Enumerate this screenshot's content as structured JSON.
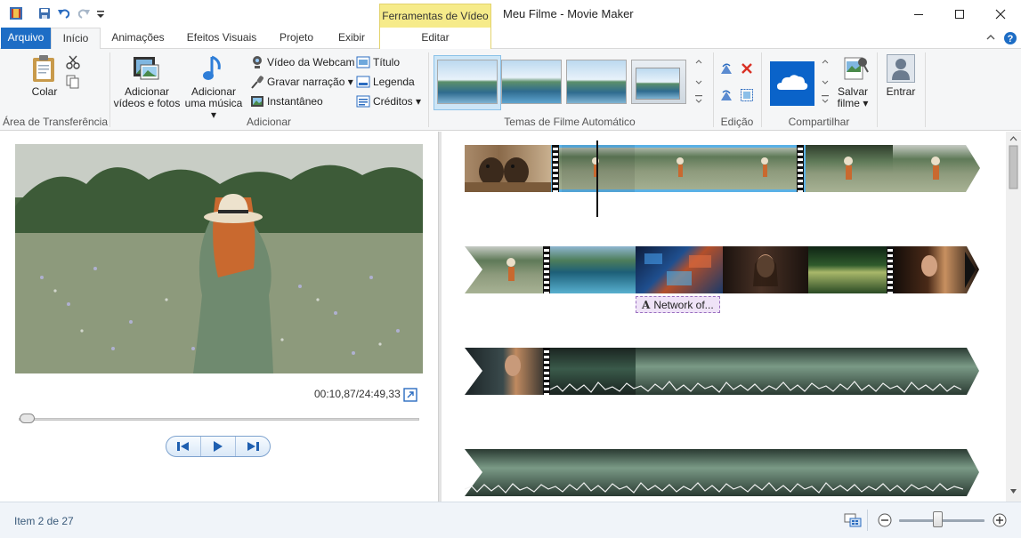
{
  "window": {
    "title": "Meu Filme - Movie Maker",
    "context_tab_header": "Ferramentas de Vídeo"
  },
  "tabs": {
    "file": "Arquivo",
    "home": "Início",
    "animations": "Animações",
    "visual_effects": "Efeitos Visuais",
    "project": "Projeto",
    "view": "Exibir",
    "edit": "Editar"
  },
  "ribbon": {
    "clipboard": {
      "paste": "Colar",
      "group": "Área de Transferência"
    },
    "add": {
      "add_videos_l1": "Adicionar",
      "add_videos_l2": "vídeos e fotos",
      "add_music_l1": "Adicionar",
      "add_music_l2": "uma música",
      "webcam": "Vídeo da Webcam",
      "narration": "Gravar narração",
      "snapshot": "Instantâneo",
      "title": "Título",
      "caption": "Legenda",
      "credits": "Créditos",
      "group": "Adicionar"
    },
    "themes": {
      "group": "Temas de Filme Automático"
    },
    "editing": {
      "group": "Edição"
    },
    "share": {
      "save_l1": "Salvar",
      "save_l2": "filme",
      "group": "Compartilhar"
    },
    "signin": {
      "label": "Entrar"
    }
  },
  "preview": {
    "time": "00:10,87/24:49,33",
    "progress": 0.007
  },
  "storyboard": {
    "caption_item": "Network of...",
    "caption_icon": "A"
  },
  "status": {
    "item": "Item 2 de 27",
    "zoom_level": 0.45
  },
  "colors": {
    "accent": "#1d6dc5",
    "context_tab": "#f6eb8a",
    "selection": "#6fb3e3"
  }
}
